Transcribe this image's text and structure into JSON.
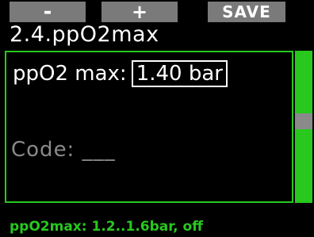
{
  "softkeys": {
    "minus": "-",
    "plus": "+",
    "save": "SAVE"
  },
  "title": "2.4.ppO2max",
  "setting": {
    "label": "ppO2 max:",
    "value": "1.40 bar"
  },
  "code": {
    "label": "Code: ___"
  },
  "scrollbar": {
    "position": 0.5
  },
  "hint": "ppO2max: 1.2..1.6bar, off",
  "colors": {
    "accent": "#28c81e",
    "softkey": "#7a7a7a",
    "background": "#000000"
  }
}
